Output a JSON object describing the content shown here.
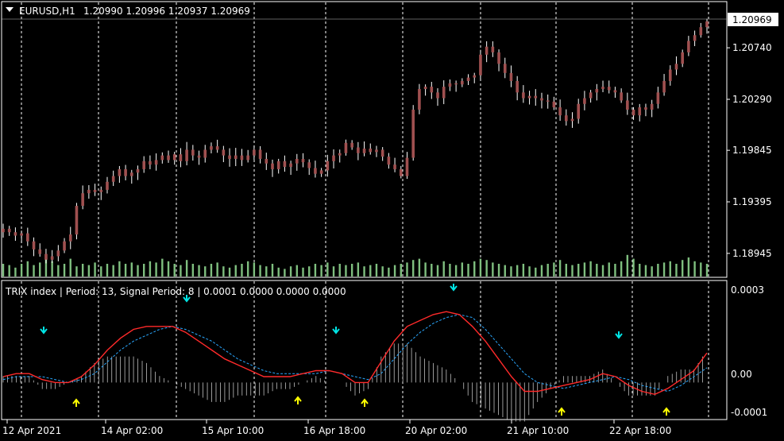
{
  "main_chart": {
    "collapse_icon": "triangle-down-icon",
    "title": "EURUSD,H1",
    "ohlc": "1.20990 1.20996 1.20937 1.20969",
    "current_price": "1.20969",
    "price_ticks": [
      "1.20740",
      "1.20290",
      "1.19845",
      "1.19395",
      "1.18945"
    ],
    "time_ticks": [
      "12 Apr 2021",
      "14 Apr 02:00",
      "15 Apr 10:00",
      "16 Apr 18:00",
      "20 Apr 02:00",
      "21 Apr 10:00",
      "22 Apr 18:00"
    ]
  },
  "indicator": {
    "title": "TRIX index | Period: 13, Signal Period: 8 |  0.0001 0.0000 0.0000 0.0000",
    "ticks": [
      "0.0003",
      "0.00",
      "-0.0001"
    ]
  },
  "colors": {
    "background": "#000000",
    "grid": "#ffffff",
    "candle": "#a05050",
    "candle_wick": "#ffffff",
    "volume": "#7fbf7f",
    "trix": "#ff2a2a",
    "signal": "#2aa8ff",
    "histogram": "#c0c0c0",
    "arrow_up": "#ffff00",
    "arrow_down": "#00e5e5"
  },
  "chart_data": {
    "type": "candlestick",
    "symbol": "EURUSD",
    "timeframe": "H1",
    "ylim": [
      1.1875,
      1.2106
    ],
    "close_series": [
      1.1916,
      1.1913,
      1.191,
      1.1912,
      1.1905,
      1.1898,
      1.1894,
      1.1889,
      1.1892,
      1.1897,
      1.1905,
      1.1911,
      1.1936,
      1.1947,
      1.195,
      1.1948,
      1.195,
      1.1957,
      1.1962,
      1.1968,
      1.1962,
      1.1965,
      1.1968,
      1.1975,
      1.1972,
      1.1976,
      1.198,
      1.1976,
      1.1981,
      1.1975,
      1.1985,
      1.198,
      1.1978,
      1.1985,
      1.1988,
      1.1985,
      1.198,
      1.1977,
      1.198,
      1.1976,
      1.198,
      1.1985,
      1.1977,
      1.1973,
      1.1968,
      1.1975,
      1.197,
      1.1973,
      1.1977,
      1.1974,
      1.1969,
      1.1964,
      1.1967,
      1.1975,
      1.198,
      1.1982,
      1.1991,
      1.1987,
      1.1982,
      1.1986,
      1.1983,
      1.1985,
      1.1979,
      1.1972,
      1.1968,
      1.1962,
      1.1978,
      1.202,
      1.2038,
      1.204,
      1.2035,
      1.203,
      1.204,
      1.2043,
      1.2042,
      1.2045,
      1.2048,
      1.205,
      1.2068,
      1.2075,
      1.207,
      1.206,
      1.2052,
      1.2045,
      1.2035,
      1.203,
      1.2032,
      1.203,
      1.2028,
      1.2027,
      1.2022,
      1.2015,
      1.201,
      1.2012,
      1.2025,
      1.203,
      1.2035,
      1.2038,
      1.204,
      1.2037,
      1.2035,
      1.2028,
      1.202,
      1.2015,
      1.2022,
      1.202,
      1.2025,
      1.2035,
      1.2045,
      1.2055,
      1.206,
      1.207,
      1.208,
      1.2085,
      1.2092,
      1.2097
    ],
    "volume_series": [
      0.5,
      0.45,
      0.35,
      0.5,
      0.6,
      0.45,
      0.55,
      0.8,
      0.6,
      0.45,
      0.5,
      0.7,
      0.4,
      0.5,
      0.45,
      0.55,
      0.4,
      0.5,
      0.45,
      0.6,
      0.5,
      0.55,
      0.45,
      0.5,
      0.6,
      0.55,
      0.7,
      0.6,
      0.5,
      0.45,
      0.65,
      0.5,
      0.45,
      0.4,
      0.5,
      0.55,
      0.4,
      0.35,
      0.45,
      0.5,
      0.6,
      0.55,
      0.45,
      0.4,
      0.5,
      0.35,
      0.3,
      0.4,
      0.45,
      0.35,
      0.4,
      0.5,
      0.45,
      0.55,
      0.4,
      0.5,
      0.45,
      0.5,
      0.55,
      0.4,
      0.45,
      0.5,
      0.4,
      0.35,
      0.45,
      0.5,
      0.55,
      0.65,
      0.7,
      0.55,
      0.5,
      0.45,
      0.6,
      0.5,
      0.45,
      0.55,
      0.5,
      0.6,
      0.7,
      0.65,
      0.55,
      0.5,
      0.45,
      0.4,
      0.45,
      0.5,
      0.4,
      0.35,
      0.45,
      0.5,
      0.55,
      0.65,
      0.5,
      0.45,
      0.5,
      0.55,
      0.6,
      0.5,
      0.45,
      0.55,
      0.5,
      0.6,
      0.85,
      0.7,
      0.5,
      0.45,
      0.4,
      0.5,
      0.55,
      0.6,
      0.5,
      0.65,
      0.75,
      0.6,
      0.55,
      0.5
    ],
    "indicator": {
      "name": "TRIX index",
      "period": 13,
      "signal_period": 8,
      "ylim": [
        -0.00012,
        0.00034
      ],
      "trix": [
        2e-05,
        3e-05,
        3e-05,
        1e-05,
        0.0,
        0.0,
        2e-05,
        6e-05,
        0.00011,
        0.00015,
        0.00018,
        0.00019,
        0.00019,
        0.00019,
        0.00017,
        0.00014,
        0.00011,
        8e-05,
        6e-05,
        4e-05,
        2e-05,
        2e-05,
        2e-05,
        3e-05,
        4e-05,
        4e-05,
        3e-05,
        0.0,
        0.0,
        7e-05,
        0.00014,
        0.00019,
        0.00021,
        0.00023,
        0.00024,
        0.00023,
        0.00019,
        0.00014,
        8e-05,
        2e-05,
        -3e-05,
        -3e-05,
        -2e-05,
        -1e-05,
        0.0,
        1e-05,
        3e-05,
        2e-05,
        -1e-05,
        -3e-05,
        -4e-05,
        -2e-05,
        1e-05,
        4e-05,
        0.0001
      ],
      "signal": [
        1e-05,
        2e-05,
        2e-05,
        2e-05,
        1e-05,
        0.0,
        1e-05,
        3e-05,
        7e-05,
        0.00011,
        0.00014,
        0.00016,
        0.00018,
        0.00019,
        0.00018,
        0.00016,
        0.00014,
        0.00011,
        8e-05,
        6e-05,
        4e-05,
        3e-05,
        3e-05,
        3e-05,
        3e-05,
        4e-05,
        3e-05,
        2e-05,
        1e-05,
        3e-05,
        8e-05,
        0.00013,
        0.00017,
        0.0002,
        0.00022,
        0.00023,
        0.00022,
        0.00018,
        0.00013,
        8e-05,
        3e-05,
        0.0,
        -1e-05,
        -2e-05,
        -1e-05,
        0.0,
        1e-05,
        2e-05,
        1e-05,
        -1e-05,
        -2e-05,
        -3e-05,
        -1e-05,
        2e-05,
        5e-05
      ]
    }
  }
}
